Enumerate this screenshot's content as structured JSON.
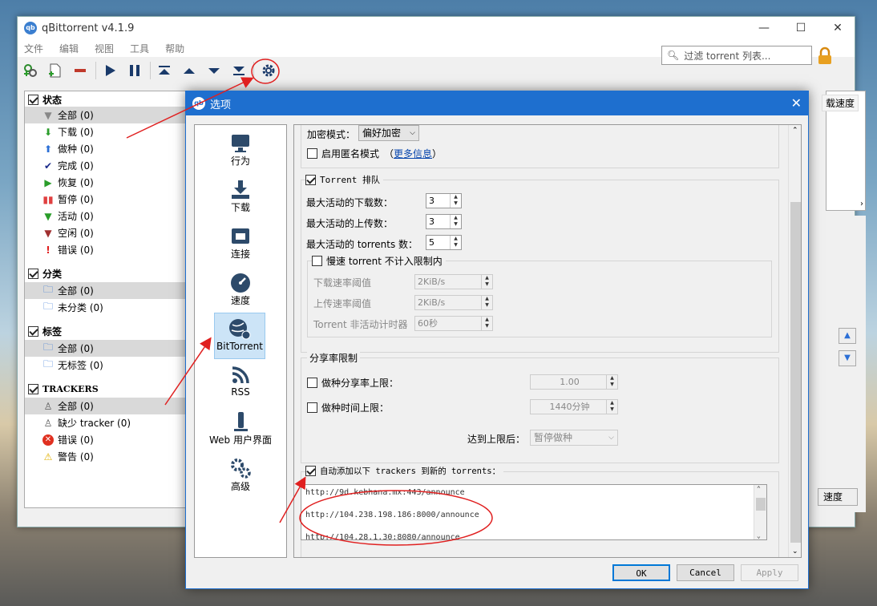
{
  "window": {
    "title": "qBittorrent v4.1.9",
    "app_icon": "qb"
  },
  "menu": [
    "文件",
    "编辑",
    "视图",
    "工具",
    "帮助"
  ],
  "filter": {
    "placeholder": "过滤 torrent 列表..."
  },
  "sidebar": {
    "status": {
      "title": "状态",
      "items": [
        {
          "label": "全部 (0)",
          "icon": "filter-icon",
          "color": "#888"
        },
        {
          "label": "下载 (0)",
          "icon": "down-arrow-icon",
          "color": "#2a9d2a"
        },
        {
          "label": "做种 (0)",
          "icon": "up-arrow-icon",
          "color": "#2b6fd6"
        },
        {
          "label": "完成 (0)",
          "icon": "checkmark-icon",
          "color": "#1a2a8a"
        },
        {
          "label": "恢复 (0)",
          "icon": "play-icon",
          "color": "#2a9d2a"
        },
        {
          "label": "暂停 (0)",
          "icon": "pause-icon",
          "color": "#e04040"
        },
        {
          "label": "活动 (0)",
          "icon": "filter-icon",
          "color": "#2a9d2a"
        },
        {
          "label": "空闲 (0)",
          "icon": "filter-icon",
          "color": "#a03030"
        },
        {
          "label": "错误 (0)",
          "icon": "exclamation-icon",
          "color": "#e02020"
        }
      ]
    },
    "category": {
      "title": "分类",
      "items": [
        "全部 (0)",
        "未分类 (0)"
      ]
    },
    "tags": {
      "title": "标签",
      "items": [
        "全部 (0)",
        "无标签 (0)"
      ]
    },
    "trackers": {
      "title": "TRACKERS",
      "items": [
        {
          "label": "全部 (0)",
          "icon": "server-icon"
        },
        {
          "label": "缺少 tracker (0)",
          "icon": "server-icon"
        },
        {
          "label": "错误 (0)",
          "icon": "error-icon"
        },
        {
          "label": "警告 (0)",
          "icon": "warning-icon"
        }
      ]
    }
  },
  "right_panel": {
    "column": "载速度",
    "speed_button": "速度"
  },
  "dialog": {
    "title": "选项",
    "nav": [
      {
        "label": "行为",
        "icon": "monitor-icon"
      },
      {
        "label": "下载",
        "icon": "download-icon"
      },
      {
        "label": "连接",
        "icon": "network-icon"
      },
      {
        "label": "速度",
        "icon": "speedometer-icon"
      },
      {
        "label": "BitTorrent",
        "icon": "bittorrent-globe-icon"
      },
      {
        "label": "RSS",
        "icon": "rss-icon"
      },
      {
        "label": "Web 用户界面",
        "icon": "web-ui-icon"
      },
      {
        "label": "高级",
        "icon": "gears-icon"
      }
    ],
    "encryption": {
      "label": "加密模式：",
      "value": "偏好加密"
    },
    "anonymous": {
      "label": "启用匿名模式",
      "link_open": "（",
      "link": "更多信息",
      "link_close": "）"
    },
    "queue": {
      "title": "Torrent 排队",
      "max_downloads": {
        "label": "最大活动的下载数：",
        "value": "3"
      },
      "max_uploads": {
        "label": "最大活动的上传数：",
        "value": "3"
      },
      "max_torrents": {
        "label": "最大活动的 torrents 数：",
        "value": "5"
      },
      "slow": {
        "title": "慢速 torrent 不计入限制内",
        "dl_threshold": {
          "label": "下载速率阈值",
          "value": "2KiB/s"
        },
        "ul_threshold": {
          "label": "上传速率阈值",
          "value": "2KiB/s"
        },
        "inactive_timer": {
          "label": "Torrent 非活动计时器",
          "value": "60秒"
        }
      }
    },
    "share": {
      "title": "分享率限制",
      "ratio": {
        "label": "做种分享率上限：",
        "value": "1.00"
      },
      "time": {
        "label": "做种时间上限：",
        "value": "1440分钟"
      },
      "action": {
        "label": "达到上限后：",
        "value": "暂停做种"
      }
    },
    "trackers": {
      "title": "自动添加以下 trackers 到新的 torrents：",
      "lines": [
        "http://9d.kebhana.mx:443/announce",
        "http://104.238.198.186:8000/announce",
        "http://104.28.1.30:8080/announce"
      ]
    },
    "buttons": {
      "ok": "OK",
      "cancel": "Cancel",
      "apply": "Apply"
    }
  },
  "colors": {
    "accent": "#1e6fcf",
    "annotation": "#e02020",
    "selected": "#d9d9d9"
  }
}
